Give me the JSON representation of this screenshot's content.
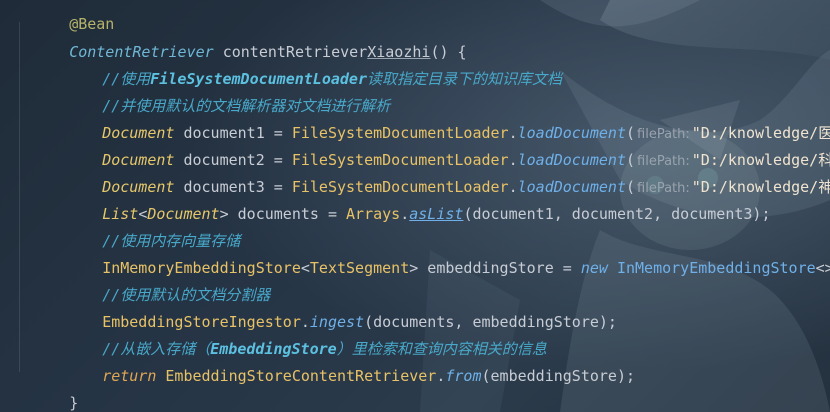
{
  "editor": {
    "lines": {
      "l0": {
        "annotation": "@Bean"
      },
      "l1": {
        "return_type": "ContentRetriever",
        "method_name": "contentRetriever",
        "method_suffix": "Xiaozhi",
        "tail": "() {"
      },
      "l2": {
        "prefix": "//使用",
        "bold": "FileSystemDocumentLoader",
        "suffix": "读取指定目录下的知识库文档"
      },
      "l3": {
        "text": "//并使用默认的文档解析器对文档进行解析"
      },
      "l4": {
        "type": "Document",
        "var": " document1 ",
        "eq": "= ",
        "cls": "FileSystemDocumentLoader",
        "dot": ".",
        "method": "loadDocument",
        "open": "(",
        "hint": "filePath:",
        "str": "\"D:/knowledge/医院信息.md\"",
        "close": ");"
      },
      "l5": {
        "type": "Document",
        "var": " document2 ",
        "eq": "= ",
        "cls": "FileSystemDocumentLoader",
        "dot": ".",
        "method": "loadDocument",
        "open": "(",
        "hint": "filePath:",
        "str": "\"D:/knowledge/科室信息.md\"",
        "close": ");"
      },
      "l6": {
        "type": "Document",
        "var": " document3 ",
        "eq": "= ",
        "cls": "FileSystemDocumentLoader",
        "dot": ".",
        "method": "loadDocument",
        "open": "(",
        "hint": "filePath:",
        "str": "\"D:/knowledge/神经内科.md\"",
        "close": ");"
      },
      "l7": {
        "list": "List",
        "lt": "<",
        "type": "Document",
        "gt": ">",
        "var": " documents ",
        "eq": "= ",
        "cls": "Arrays",
        "dot": ".",
        "method": "asList",
        "args": "(document1, document2, document3);"
      },
      "l8": {
        "text": "//使用内存向量存储"
      },
      "l9": {
        "cls": "InMemoryEmbeddingStore",
        "lt": "<",
        "cls2": "TextSegment",
        "gt": ">",
        "var": " embeddingStore ",
        "eq": "= ",
        "kw": "new ",
        "cls3": "InMemoryEmbeddingStore",
        "tail": "<>();"
      },
      "l10": {
        "text": "//使用默认的文档分割器"
      },
      "l11": {
        "cls": "EmbeddingStoreIngestor",
        "dot": ".",
        "method": "ingest",
        "args": "(documents, embeddingStore);"
      },
      "l12": {
        "prefix": "//从嵌入存储（",
        "bold": "EmbeddingStore",
        "suffix": "）里检索和查询内容相关的信息"
      },
      "l13": {
        "kw": "return ",
        "cls": "EmbeddingStoreContentRetriever",
        "dot": ".",
        "method": "from",
        "args": "(embeddingStore);"
      },
      "l14": {
        "text": "}"
      }
    }
  }
}
